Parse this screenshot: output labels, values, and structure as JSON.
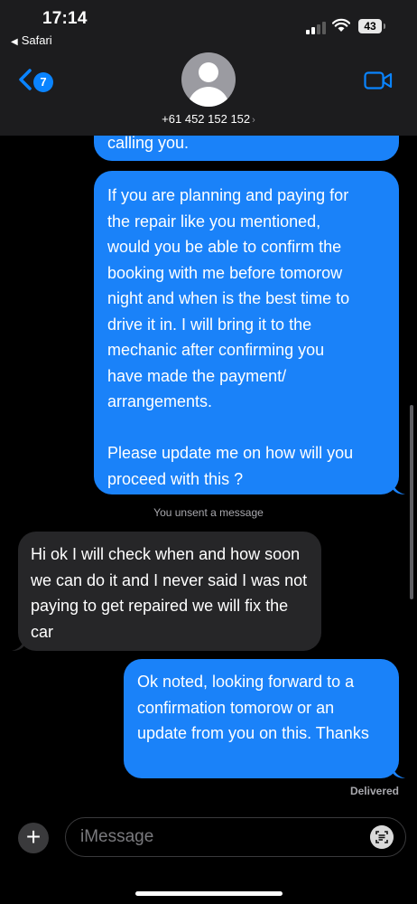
{
  "status_bar": {
    "time": "17:14",
    "back_app": "Safari",
    "battery": "43"
  },
  "header": {
    "unread_count": "7",
    "contact": "+61 452 152 152"
  },
  "messages": [
    {
      "direction": "sent",
      "text": "calling you.",
      "partial": true
    },
    {
      "direction": "sent",
      "text": "If you are planning and paying for\nthe repair like you mentioned,\nwould you be able to confirm the\nbooking with me before tomorow\nnight and when is the best time to\ndrive it in. I will bring it to the\nmechanic after confirming you\nhave made the payment/\narrangements.\n\nPlease update me on how will you\nproceed with this ?"
    },
    {
      "direction": "received",
      "text": "Hi ok I will check when and how soon we can do it and I never said I was not paying to get repaired we will fix the car"
    },
    {
      "direction": "sent",
      "text": "Ok noted, looking forward to a confirmation tomorow or an update from you on this. Thanks"
    }
  ],
  "system_note": "You unsent a message",
  "delivery_status": "Delivered",
  "composer": {
    "placeholder": "iMessage"
  },
  "colors": {
    "sent_bubble": "#1a82f9",
    "received_bubble": "#262628",
    "accent": "#0a84ff",
    "background": "#000000"
  },
  "icons": [
    "back-chevron-icon",
    "video-camera-icon",
    "plus-icon",
    "scan-text-icon",
    "signal-icon",
    "wifi-icon",
    "battery-icon"
  ]
}
